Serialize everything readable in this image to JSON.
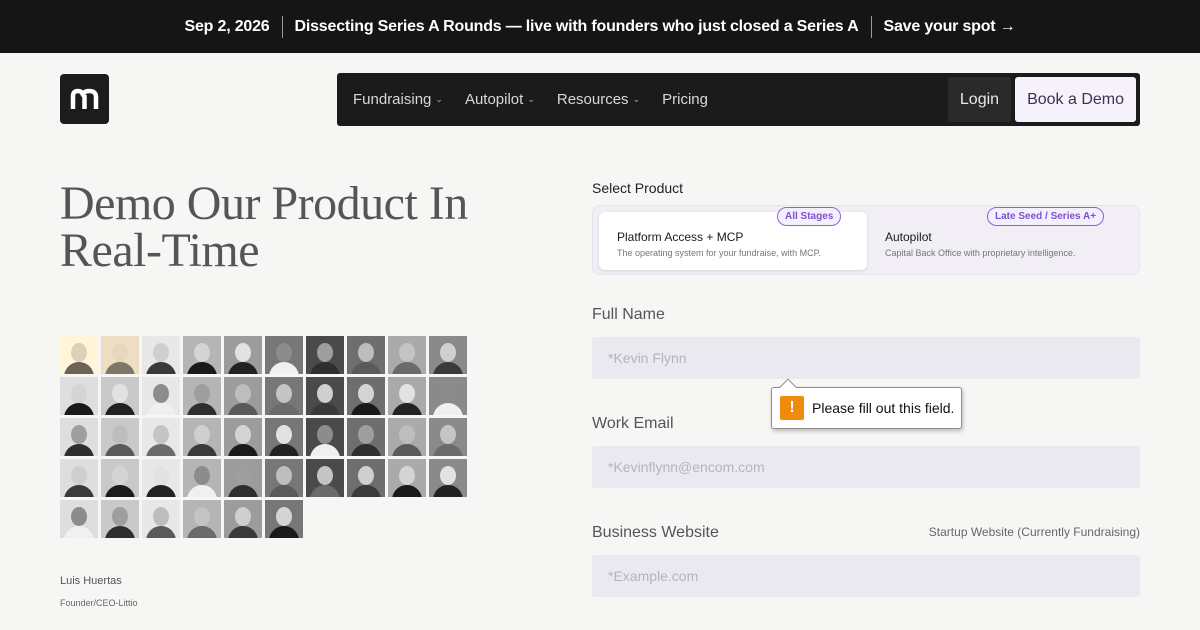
{
  "banner": {
    "date": "Sep 2, 2026",
    "event": "Dissecting Series A Rounds — live with founders who just closed a Series A",
    "cta": "Save your spot →"
  },
  "logo": {
    "letter": "m"
  },
  "nav": {
    "items": [
      {
        "label": "Fundraising",
        "has_dropdown": true
      },
      {
        "label": "Autopilot",
        "has_dropdown": true
      },
      {
        "label": "Resources",
        "has_dropdown": true
      },
      {
        "label": "Pricing",
        "has_dropdown": false
      }
    ],
    "login": "Login",
    "book_demo": "Book a Demo"
  },
  "hero": {
    "title_line1": "Demo Our Product In",
    "title_line2": "Real-Time"
  },
  "testimonial": {
    "name": "Luis Huertas",
    "role": "Founder/CEO-Littio"
  },
  "form": {
    "select_product_label": "Select Product",
    "products": [
      {
        "title": "Platform Access + MCP",
        "description": "The operating system for your fundraise, with MCP.",
        "badge": "All Stages",
        "selected": true
      },
      {
        "title": "Autopilot",
        "description": "Capital Back Office with proprietary intelligence.",
        "badge": "Late Seed / Series A+",
        "selected": false
      }
    ],
    "full_name": {
      "label": "Full Name",
      "placeholder": "*Kevin Flynn",
      "value": ""
    },
    "work_email": {
      "label": "Work Email",
      "placeholder": "*Kevinflynn@encom.com",
      "value": ""
    },
    "business_website": {
      "label": "Business Website",
      "hint": "Startup Website (Currently Fundraising)",
      "placeholder": "*Example.com",
      "value": ""
    },
    "validation_tooltip": {
      "icon": "!",
      "message": "Please fill out this field."
    }
  },
  "colors": {
    "banner_bg": "#151515",
    "nav_bg": "#1b1b1b",
    "badge_purple": "#7b52cf",
    "field_bg": "#eae9f0",
    "warning_orange": "#f08a0c"
  }
}
